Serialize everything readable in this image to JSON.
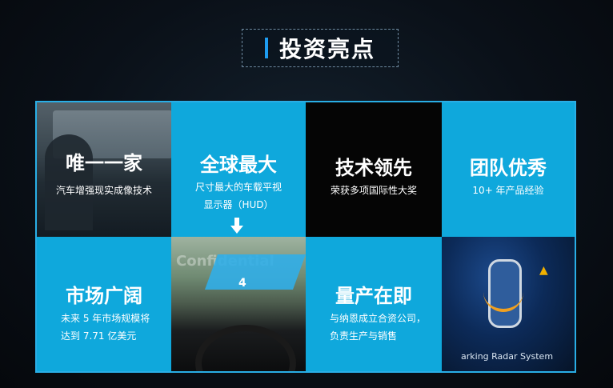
{
  "header": {
    "title": "投资亮点"
  },
  "tiles": {
    "unique": {
      "title": "唯一一家",
      "sub": "汽车增强现实成像技术"
    },
    "largest": {
      "title": "全球最大",
      "sub1": "尺寸最大的车载平视",
      "sub2": "显示器（HUD）"
    },
    "tech": {
      "title": "技术领先",
      "sub": "荣获多项国际性大奖"
    },
    "team": {
      "title": "团队优秀",
      "sub": "10+ 年产品经验"
    },
    "market": {
      "title": "市场广阔",
      "sub1": "未来 5 年市场规模将",
      "sub2": "达到 7.71 亿美元"
    },
    "production": {
      "title": "量产在即",
      "sub1": "与纳恩成立合资公司，",
      "sub2": "负责生产与销售"
    },
    "road_photo": {
      "watermark": "Confidential",
      "lane_number": "4"
    },
    "radar_photo": {
      "caption": "arking Radar System"
    }
  },
  "colors": {
    "accent": "#29aee6",
    "tile_blue": "#0fa8dc",
    "tile_black": "#050505"
  }
}
